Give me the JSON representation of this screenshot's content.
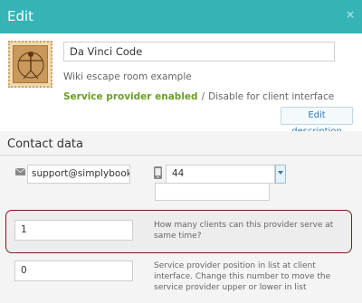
{
  "header": {
    "title": "Edit",
    "close_glyph": "×"
  },
  "provider": {
    "name": "Da Vinci Code",
    "description": "Wiki escape room example",
    "status_enabled": "Service provider enabled",
    "status_separator": "/",
    "status_disable": "Disable for client interface",
    "edit_description_label": "Edit description"
  },
  "contact": {
    "section_title": "Contact data",
    "email": "support@simplybook.me",
    "phone": "44",
    "phone_extra": ""
  },
  "capacity": {
    "value": "1",
    "help": "How many clients can this provider serve at same time?"
  },
  "position": {
    "value": "0",
    "help": "Service provider position in list at client interface. Change this number to move the service provider upper or lower in list"
  },
  "colors": {
    "header": "#36b3b5",
    "enabled": "#6a9f1f",
    "highlight_border": "#7a1f1f",
    "link": "#2f7ab4"
  },
  "icons": [
    "close-icon",
    "provider-stamp-image",
    "mail-icon",
    "phone-icon",
    "chevron-down-icon"
  ]
}
